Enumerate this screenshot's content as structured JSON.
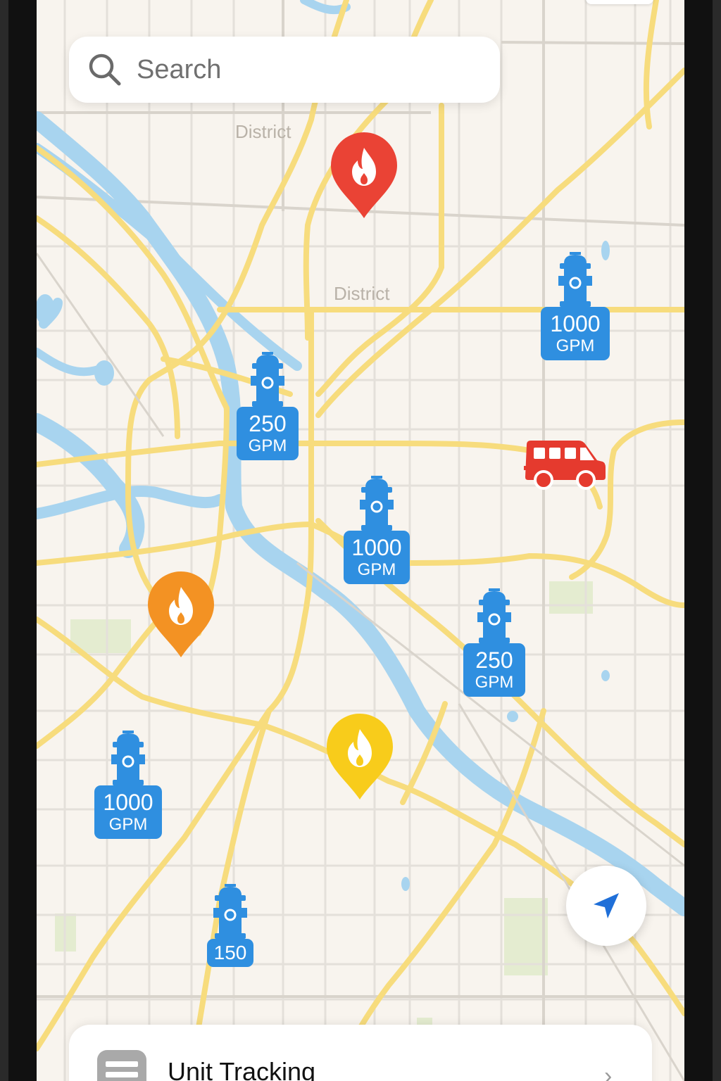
{
  "status": {
    "time": ""
  },
  "search": {
    "placeholder": "Search",
    "icon": "search-icon"
  },
  "map": {
    "district_labels": [
      "District",
      "District"
    ],
    "colors": {
      "land": "#f8f4ee",
      "road": "#f7dc7d",
      "water": "#a8d4ef",
      "park": "#e4ecd0",
      "street": "#e4e0da"
    }
  },
  "hydrants": [
    {
      "flow": "1000",
      "unit": "GPM"
    },
    {
      "flow": "250",
      "unit": "GPM"
    },
    {
      "flow": "1000",
      "unit": "GPM"
    },
    {
      "flow": "250",
      "unit": "GPM"
    },
    {
      "flow": "1000",
      "unit": "GPM"
    },
    {
      "flow": "150",
      "unit": ""
    }
  ],
  "incidents": [
    {
      "severity": "high",
      "color": "#ea4335",
      "icon": "fire-icon"
    },
    {
      "severity": "medium",
      "color": "#f39223",
      "icon": "fire-icon"
    },
    {
      "severity": "low",
      "color": "#f8cc1b",
      "icon": "fire-icon"
    }
  ],
  "unit": {
    "icon": "fire-truck-icon",
    "color": "#e53a2e"
  },
  "hydrant_color": "#2f8fe0",
  "locate_button": {
    "icon": "navigation-arrow-icon"
  },
  "bottom_card": {
    "label": "Unit Tracking",
    "icon": "list-icon",
    "chevron": "›"
  }
}
